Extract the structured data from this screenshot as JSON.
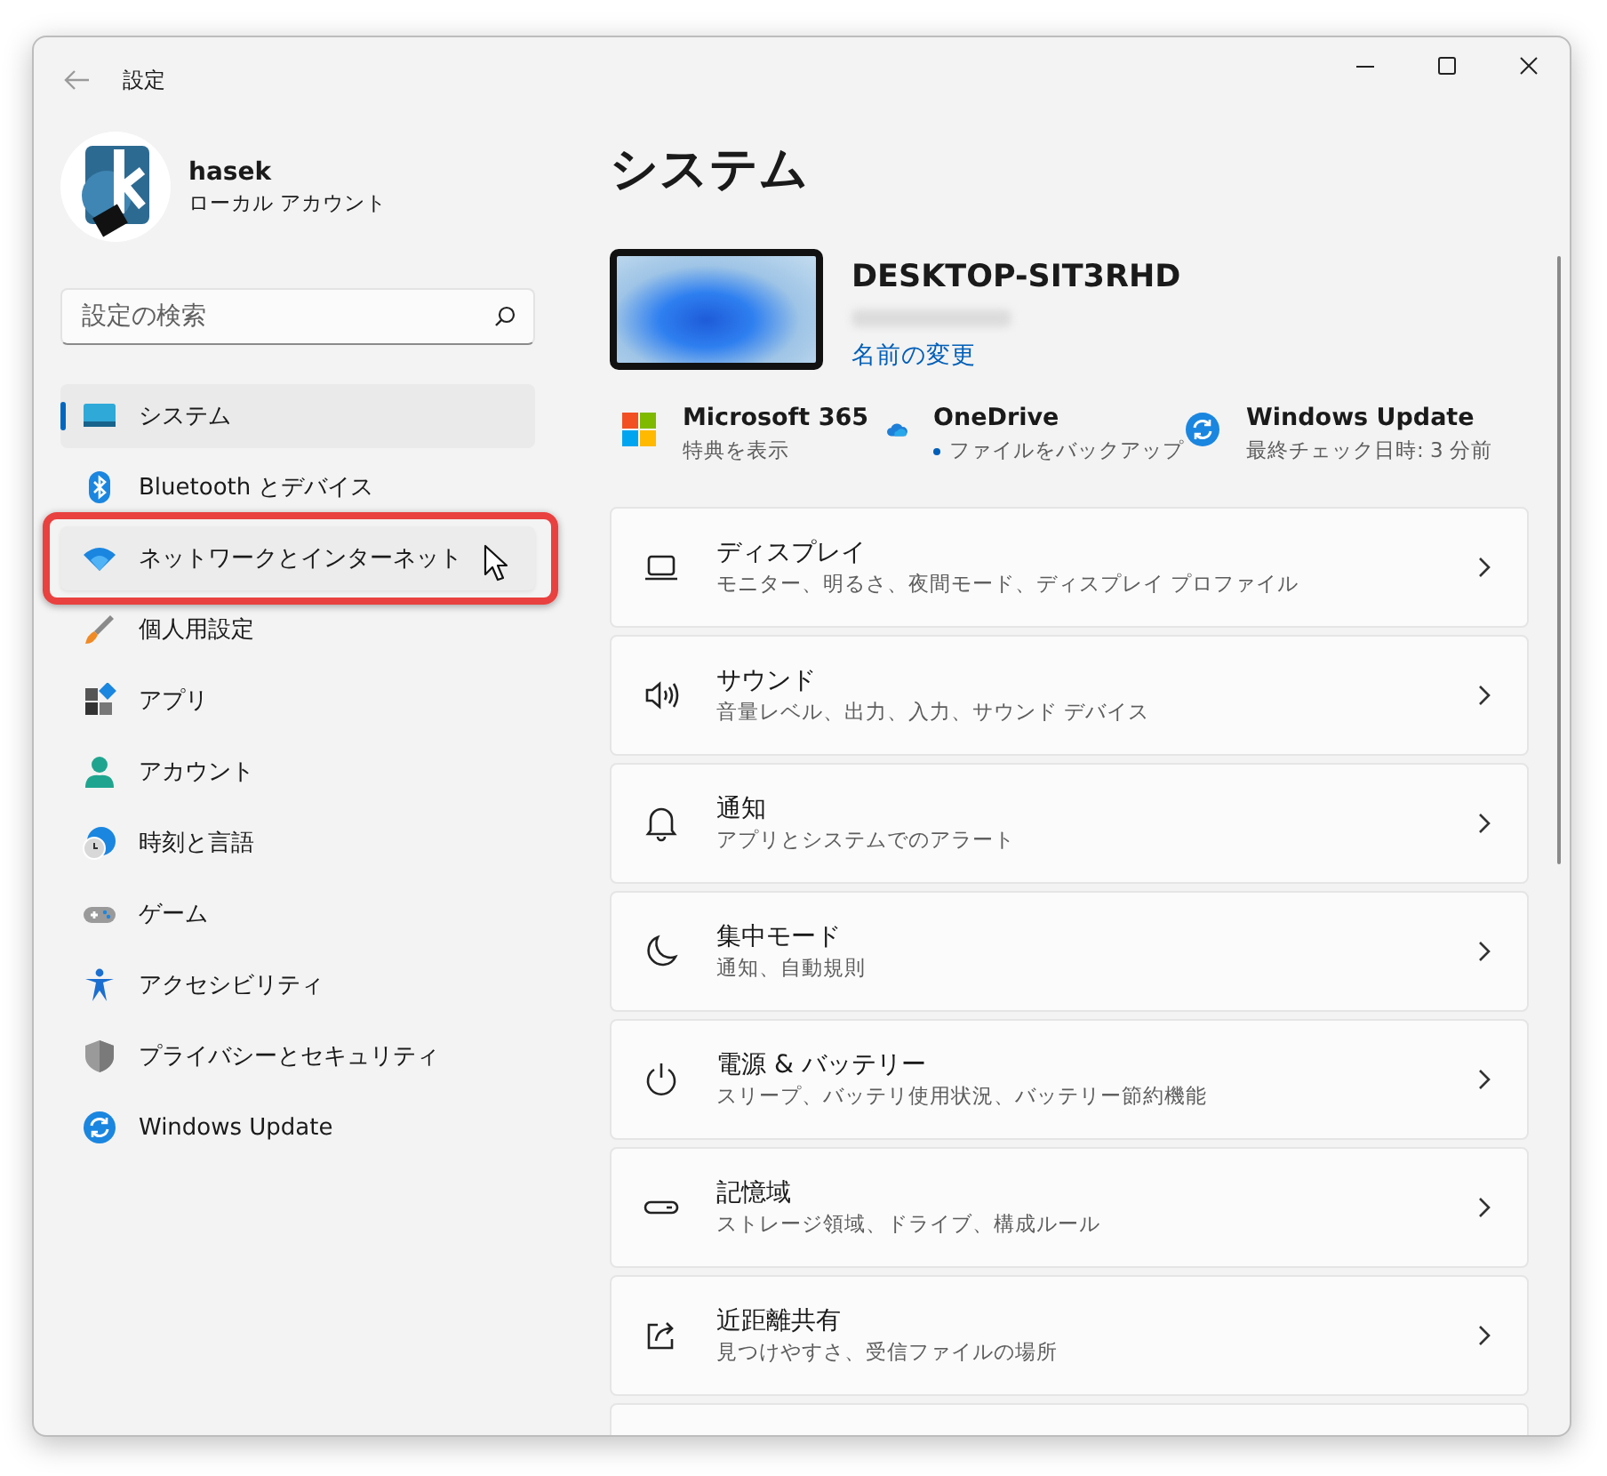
{
  "window": {
    "title": "設定"
  },
  "account": {
    "name": "hasek",
    "type": "ローカル アカウント"
  },
  "search": {
    "placeholder": "設定の検索"
  },
  "sidebar": {
    "items": [
      {
        "label": "システム",
        "selected": true,
        "hovered": false,
        "annotated": false
      },
      {
        "label": "Bluetooth とデバイス",
        "selected": false,
        "hovered": false,
        "annotated": false
      },
      {
        "label": "ネットワークとインターネット",
        "selected": false,
        "hovered": true,
        "annotated": true
      },
      {
        "label": "個人用設定",
        "selected": false,
        "hovered": false,
        "annotated": false
      },
      {
        "label": "アプリ",
        "selected": false,
        "hovered": false,
        "annotated": false
      },
      {
        "label": "アカウント",
        "selected": false,
        "hovered": false,
        "annotated": false
      },
      {
        "label": "時刻と言語",
        "selected": false,
        "hovered": false,
        "annotated": false
      },
      {
        "label": "ゲーム",
        "selected": false,
        "hovered": false,
        "annotated": false
      },
      {
        "label": "アクセシビリティ",
        "selected": false,
        "hovered": false,
        "annotated": false
      },
      {
        "label": "プライバシーとセキュリティ",
        "selected": false,
        "hovered": false,
        "annotated": false
      },
      {
        "label": "Windows Update",
        "selected": false,
        "hovered": false,
        "annotated": false
      }
    ]
  },
  "page_title": "システム",
  "device": {
    "name": "DESKTOP-SIT3RHD",
    "rename_link": "名前の変更"
  },
  "quick_links": [
    {
      "kind": "office",
      "title": "Microsoft 365",
      "subtitle": "特典を表示",
      "status_dot": false
    },
    {
      "kind": "cloud",
      "title": "OneDrive",
      "subtitle": "ファイルをバックアップ",
      "status_dot": true
    },
    {
      "kind": "update",
      "title": "Windows Update",
      "subtitle": "最終チェック日時: 3 分前",
      "status_dot": false
    }
  ],
  "cards": [
    {
      "title": "ディスプレイ",
      "subtitle": "モニター、明るさ、夜間モード、ディスプレイ プロファイル"
    },
    {
      "title": "サウンド",
      "subtitle": "音量レベル、出力、入力、サウンド デバイス"
    },
    {
      "title": "通知",
      "subtitle": "アプリとシステムでのアラート"
    },
    {
      "title": "集中モード",
      "subtitle": "通知、自動規則"
    },
    {
      "title": "電源 & バッテリー",
      "subtitle": "スリープ、バッテリ使用状況、バッテリー節約機能"
    },
    {
      "title": "記憶域",
      "subtitle": "ストレージ領域、ドライブ、構成ルール"
    },
    {
      "title": "近距離共有",
      "subtitle": "見つけやすさ、受信ファイルの場所"
    }
  ]
}
